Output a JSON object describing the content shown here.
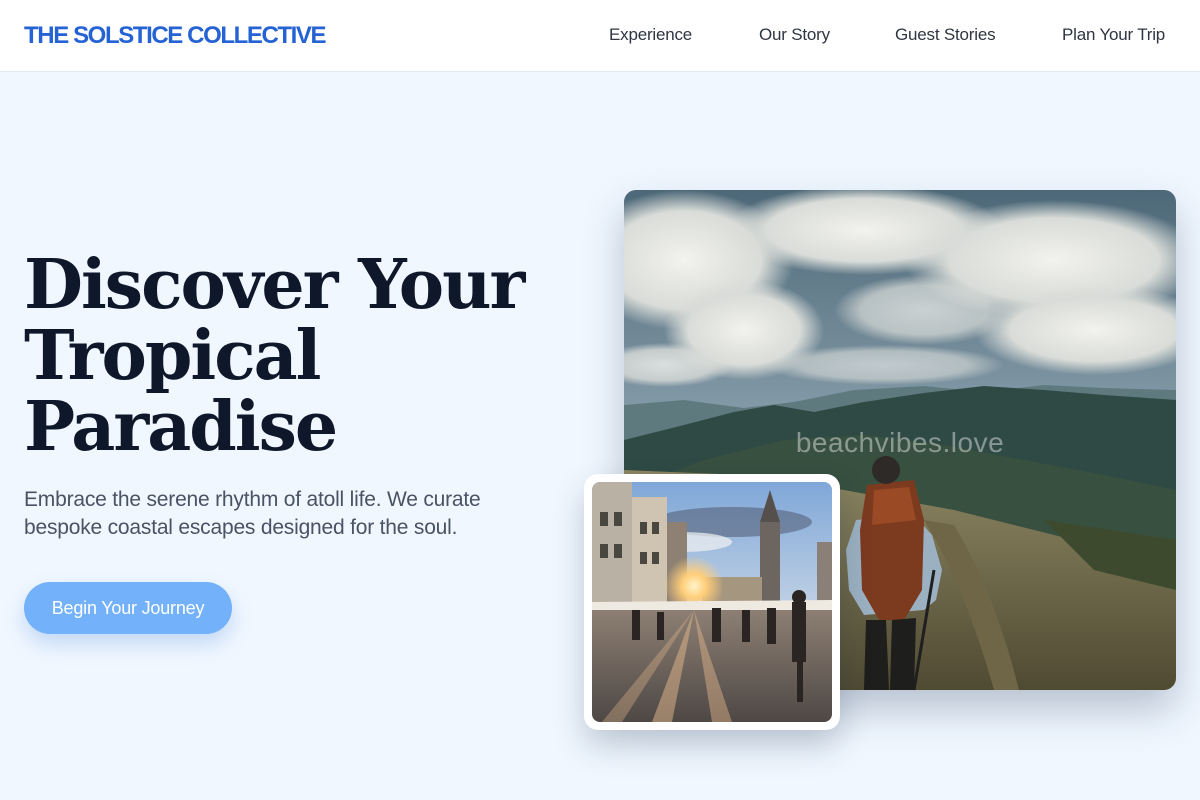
{
  "header": {
    "logo": "THE SOLSTICE COLLECTIVE",
    "nav": [
      "Experience",
      "Our Story",
      "Guest Stories",
      "Plan Your Trip"
    ]
  },
  "hero": {
    "title_lines": [
      "Discover Your",
      "Tropical",
      "Paradise"
    ],
    "subtitle": "Embrace the serene rhythm of atoll life. We curate bespoke coastal escapes designed for the soul.",
    "cta_label": "Begin Your Journey"
  },
  "images": {
    "main_watermark": "beachvibes.love"
  },
  "colors": {
    "brand": "#2563d4",
    "cta": "#73b1fb",
    "background": "#f0f7ff",
    "title": "#0f172a"
  }
}
